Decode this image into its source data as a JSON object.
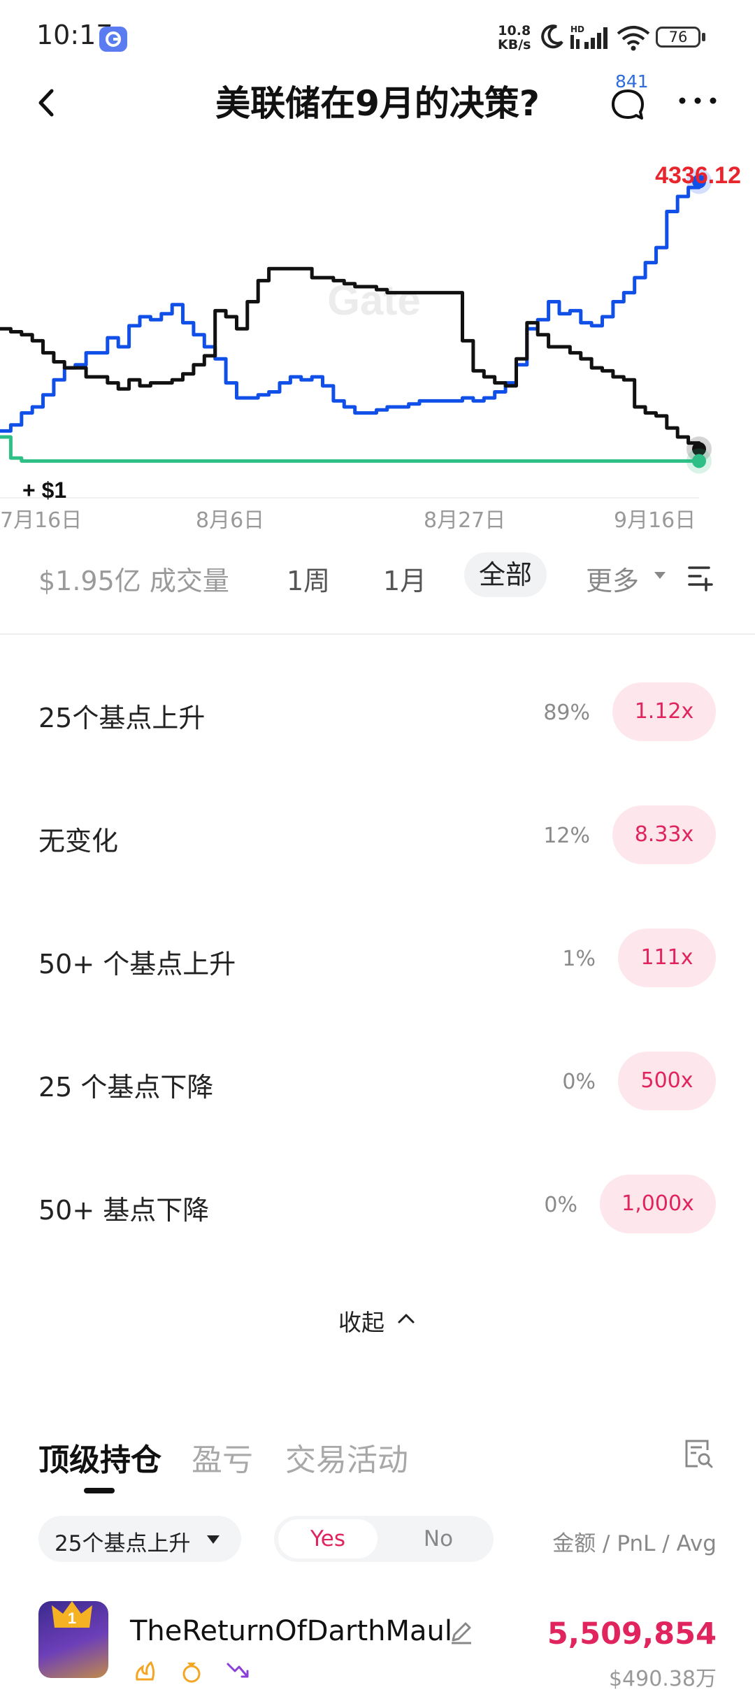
{
  "status_bar": {
    "time": "10:17",
    "net_speed_value": "10.8",
    "net_speed_unit": "KB/s",
    "signal_label": "HD",
    "battery": "76"
  },
  "header": {
    "title": "美联储在9月的决策?",
    "comment_count": "841"
  },
  "chart_data": {
    "type": "line",
    "x_tick_labels": [
      "7月16日",
      "8月6日",
      "8月27日",
      "9月16日"
    ],
    "price_label": "4336.12",
    "amount_label": "+ $1",
    "watermark": "Gate",
    "series": [
      {
        "color": "#1150e8",
        "values": [
          12,
          14,
          18,
          20,
          24,
          29,
          33,
          34,
          38,
          38,
          43,
          40,
          47,
          50,
          49,
          51,
          54,
          48,
          44,
          40,
          36,
          28,
          23,
          23,
          24,
          25,
          28,
          30,
          29,
          30,
          27,
          22,
          20,
          18,
          18,
          19,
          20,
          20,
          21,
          22,
          22,
          22,
          22,
          23,
          22,
          23,
          25,
          28,
          34,
          46,
          49,
          55,
          51,
          52,
          48,
          47,
          50,
          55,
          58,
          63,
          68,
          73,
          85,
          90,
          93,
          95
        ]
      },
      {
        "color": "#111111",
        "values": [
          46,
          45,
          44,
          42,
          38,
          35,
          33,
          33,
          30,
          30,
          28,
          26,
          29,
          27,
          28,
          28,
          29,
          31,
          34,
          37,
          52,
          50,
          46,
          55,
          62,
          66,
          66,
          66,
          66,
          63,
          63,
          62,
          61,
          60,
          60,
          59,
          58,
          58,
          58,
          58,
          58,
          58,
          58,
          42,
          32,
          30,
          28,
          27,
          36,
          48,
          44,
          40,
          40,
          38,
          36,
          33,
          32,
          30,
          29,
          20,
          18,
          17,
          13,
          10,
          8,
          6
        ]
      },
      {
        "color": "#2dbf85",
        "values": [
          10,
          3,
          2,
          2,
          2,
          2,
          2,
          2,
          2,
          2,
          2,
          2,
          2,
          2,
          2,
          2,
          2,
          2,
          2,
          2,
          2,
          2,
          2,
          2,
          2,
          2,
          2,
          2,
          2,
          2,
          2,
          2,
          2,
          2,
          2,
          2,
          2,
          2,
          2,
          2,
          2,
          2,
          2,
          2,
          2,
          2,
          2,
          2,
          2,
          2,
          2,
          2,
          2,
          2,
          2,
          2,
          2,
          2,
          2,
          2,
          2,
          2,
          2,
          2,
          2,
          2
        ]
      }
    ]
  },
  "range": {
    "volume": "$1.95亿 成交量",
    "week": "1周",
    "month": "1月",
    "all": "全部",
    "more": "更多"
  },
  "outcomes": [
    {
      "label": "25个基点上升",
      "pct": "89%",
      "mult": "1.12x"
    },
    {
      "label": "无变化",
      "pct": "12%",
      "mult": "8.33x"
    },
    {
      "label": "50+ 个基点上升",
      "pct": "1%",
      "mult": "111x"
    },
    {
      "label": "25 个基点下降",
      "pct": "0%",
      "mult": "500x"
    },
    {
      "label": "50+ 基点下降",
      "pct": "0%",
      "mult": "1,000x"
    }
  ],
  "collapse_label": "收起",
  "tabs": {
    "holdings": "顶级持仓",
    "pnl": "盈亏",
    "activity": "交易活动"
  },
  "filters": {
    "outcome": "25个基点上升",
    "yes": "Yes",
    "no": "No",
    "columns": "金额 / PnL / Avg"
  },
  "holder": {
    "rank": "1",
    "name": "TheReturnOfDarthMaul",
    "amount": "5,509,854",
    "sub_value": "$490.38万"
  }
}
